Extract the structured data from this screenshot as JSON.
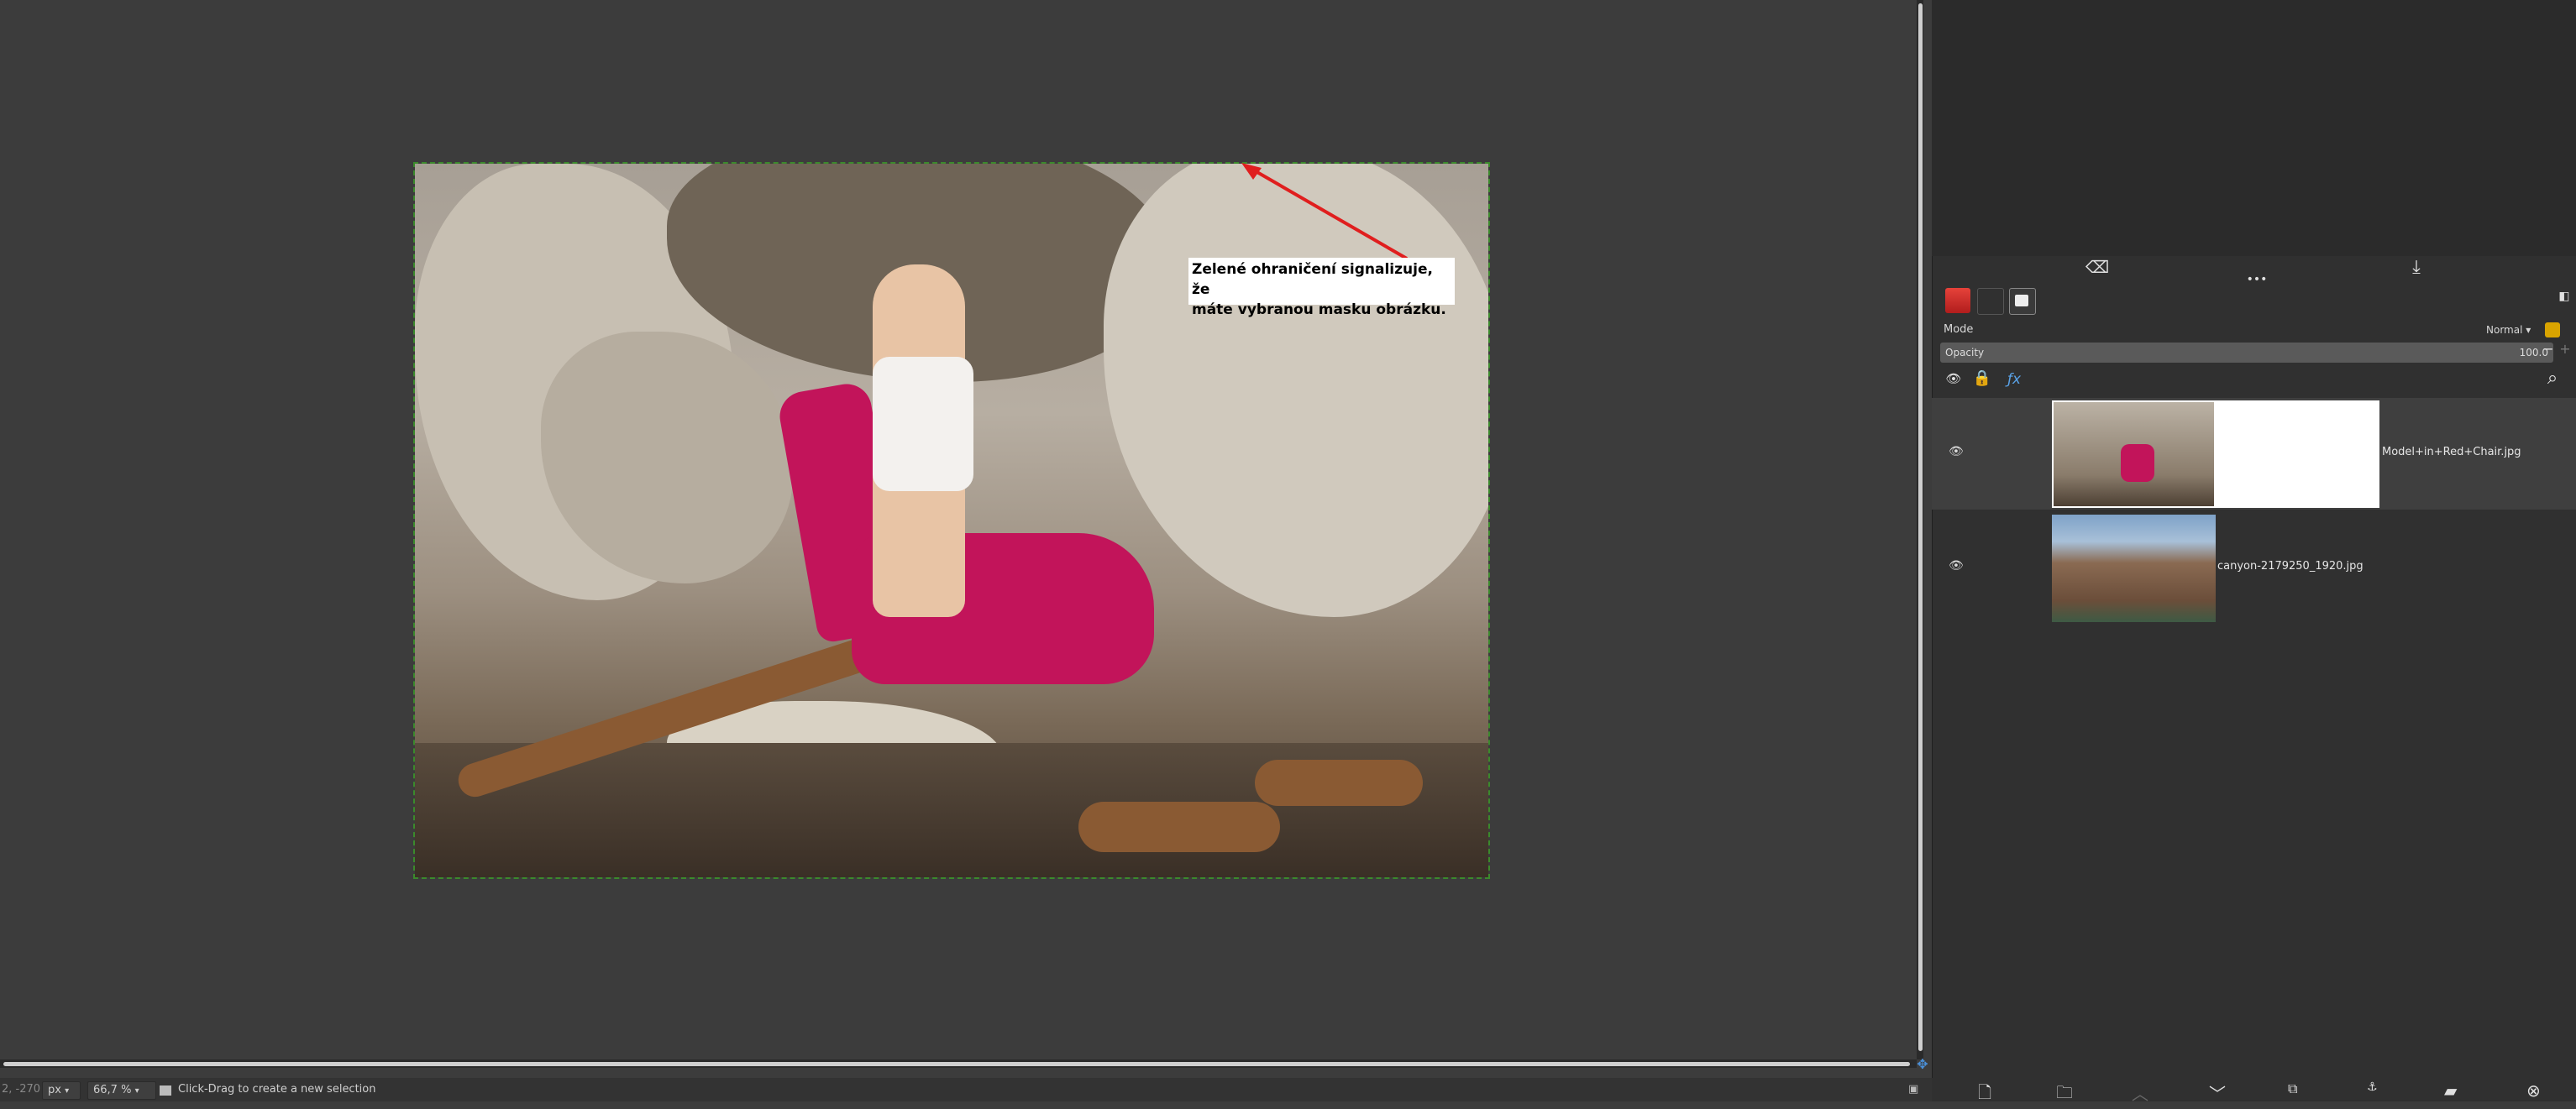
{
  "canvas": {
    "annotation_text_line1": "Zelené ohraničení signalizuje, že",
    "annotation_text_line2": "máte vybranou masku obrázku.",
    "selection_border_color": "#3b8a2c",
    "arrow_color": "#e01e1e"
  },
  "status_bar": {
    "coords": "2, -270",
    "unit": "px",
    "zoom": "66,7 %",
    "message": "Click-Drag to create a new selection"
  },
  "layers_panel": {
    "mode_label": "Mode",
    "mode_value": "Normal",
    "opacity_label": "Opacity",
    "opacity_value": "100.0",
    "layers": [
      {
        "name": "Model+in+Red+Chair.jpg",
        "visible": true,
        "has_mask": true,
        "active": true
      },
      {
        "name": "canyon-2179250_1920.jpg",
        "visible": true,
        "has_mask": false,
        "active": false
      }
    ]
  },
  "icons": {
    "tab1": "layers-icon",
    "tab2": "channels-icon",
    "tab3": "paths-icon"
  }
}
